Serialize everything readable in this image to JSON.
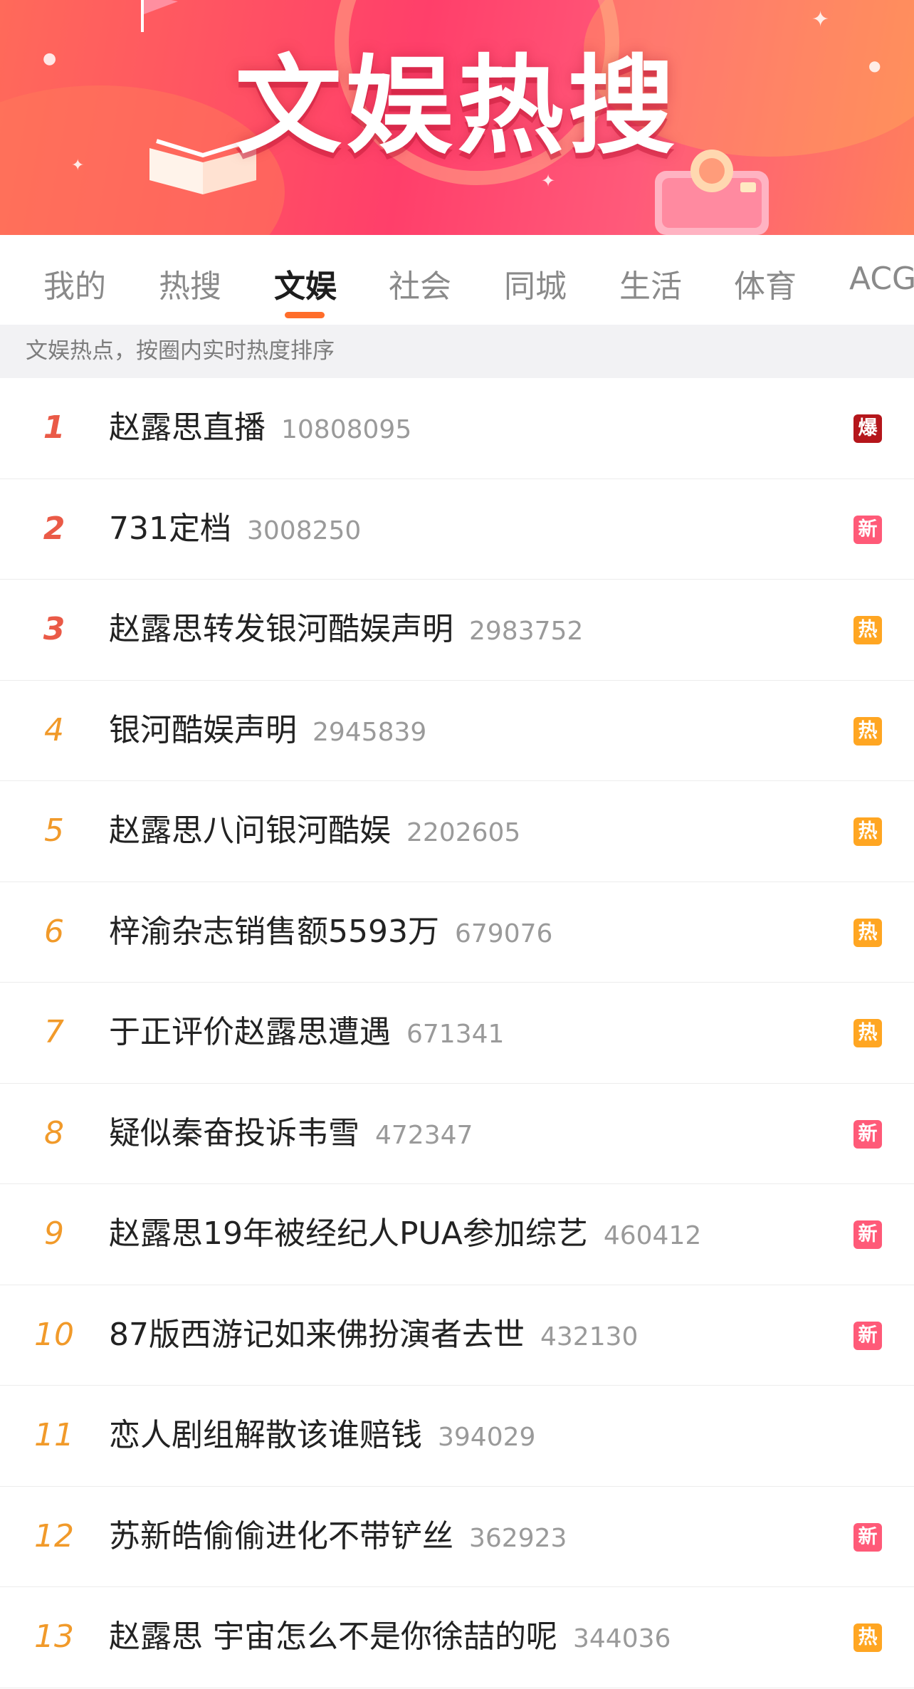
{
  "banner": {
    "title": "文娱热搜"
  },
  "tabs": [
    {
      "label": "我的",
      "active": false
    },
    {
      "label": "热搜",
      "active": false
    },
    {
      "label": "文娱",
      "active": true
    },
    {
      "label": "社会",
      "active": false
    },
    {
      "label": "同城",
      "active": false
    },
    {
      "label": "生活",
      "active": false
    },
    {
      "label": "体育",
      "active": false
    },
    {
      "label": "ACG",
      "active": false
    }
  ],
  "subheader": "文娱热点，按圈内实时热度排序",
  "colors": {
    "accent": "#ff6d2a",
    "rank_top": "#ea5a47",
    "rank_other": "#f19a2a",
    "badge_bao": "#b5161b",
    "badge_xin": "#ff5a78",
    "badge_re": "#ffa622"
  },
  "items": [
    {
      "rank": "1",
      "title": "赵露思直播",
      "heat": "10808095",
      "badge": "爆",
      "badge_type": "bao"
    },
    {
      "rank": "2",
      "title": "731定档",
      "heat": "3008250",
      "badge": "新",
      "badge_type": "xin"
    },
    {
      "rank": "3",
      "title": "赵露思转发银河酷娱声明",
      "heat": "2983752",
      "badge": "热",
      "badge_type": "re"
    },
    {
      "rank": "4",
      "title": "银河酷娱声明",
      "heat": "2945839",
      "badge": "热",
      "badge_type": "re"
    },
    {
      "rank": "5",
      "title": "赵露思八问银河酷娱",
      "heat": "2202605",
      "badge": "热",
      "badge_type": "re"
    },
    {
      "rank": "6",
      "title": "梓渝杂志销售额5593万",
      "heat": "679076",
      "badge": "热",
      "badge_type": "re"
    },
    {
      "rank": "7",
      "title": "于正评价赵露思遭遇",
      "heat": "671341",
      "badge": "热",
      "badge_type": "re"
    },
    {
      "rank": "8",
      "title": "疑似秦奋投诉韦雪",
      "heat": "472347",
      "badge": "新",
      "badge_type": "xin"
    },
    {
      "rank": "9",
      "title": "赵露思19年被经纪人PUA参加综艺",
      "heat": "460412",
      "badge": "新",
      "badge_type": "xin"
    },
    {
      "rank": "10",
      "title": "87版西游记如来佛扮演者去世",
      "heat": "432130",
      "badge": "新",
      "badge_type": "xin"
    },
    {
      "rank": "11",
      "title": "恋人剧组解散该谁赔钱",
      "heat": "394029",
      "badge": "",
      "badge_type": ""
    },
    {
      "rank": "12",
      "title": "苏新皓偷偷进化不带铲丝",
      "heat": "362923",
      "badge": "新",
      "badge_type": "xin"
    },
    {
      "rank": "13",
      "title": "赵露思 宇宙怎么不是你徐喆的呢",
      "heat": "344036",
      "badge": "热",
      "badge_type": "re"
    }
  ]
}
